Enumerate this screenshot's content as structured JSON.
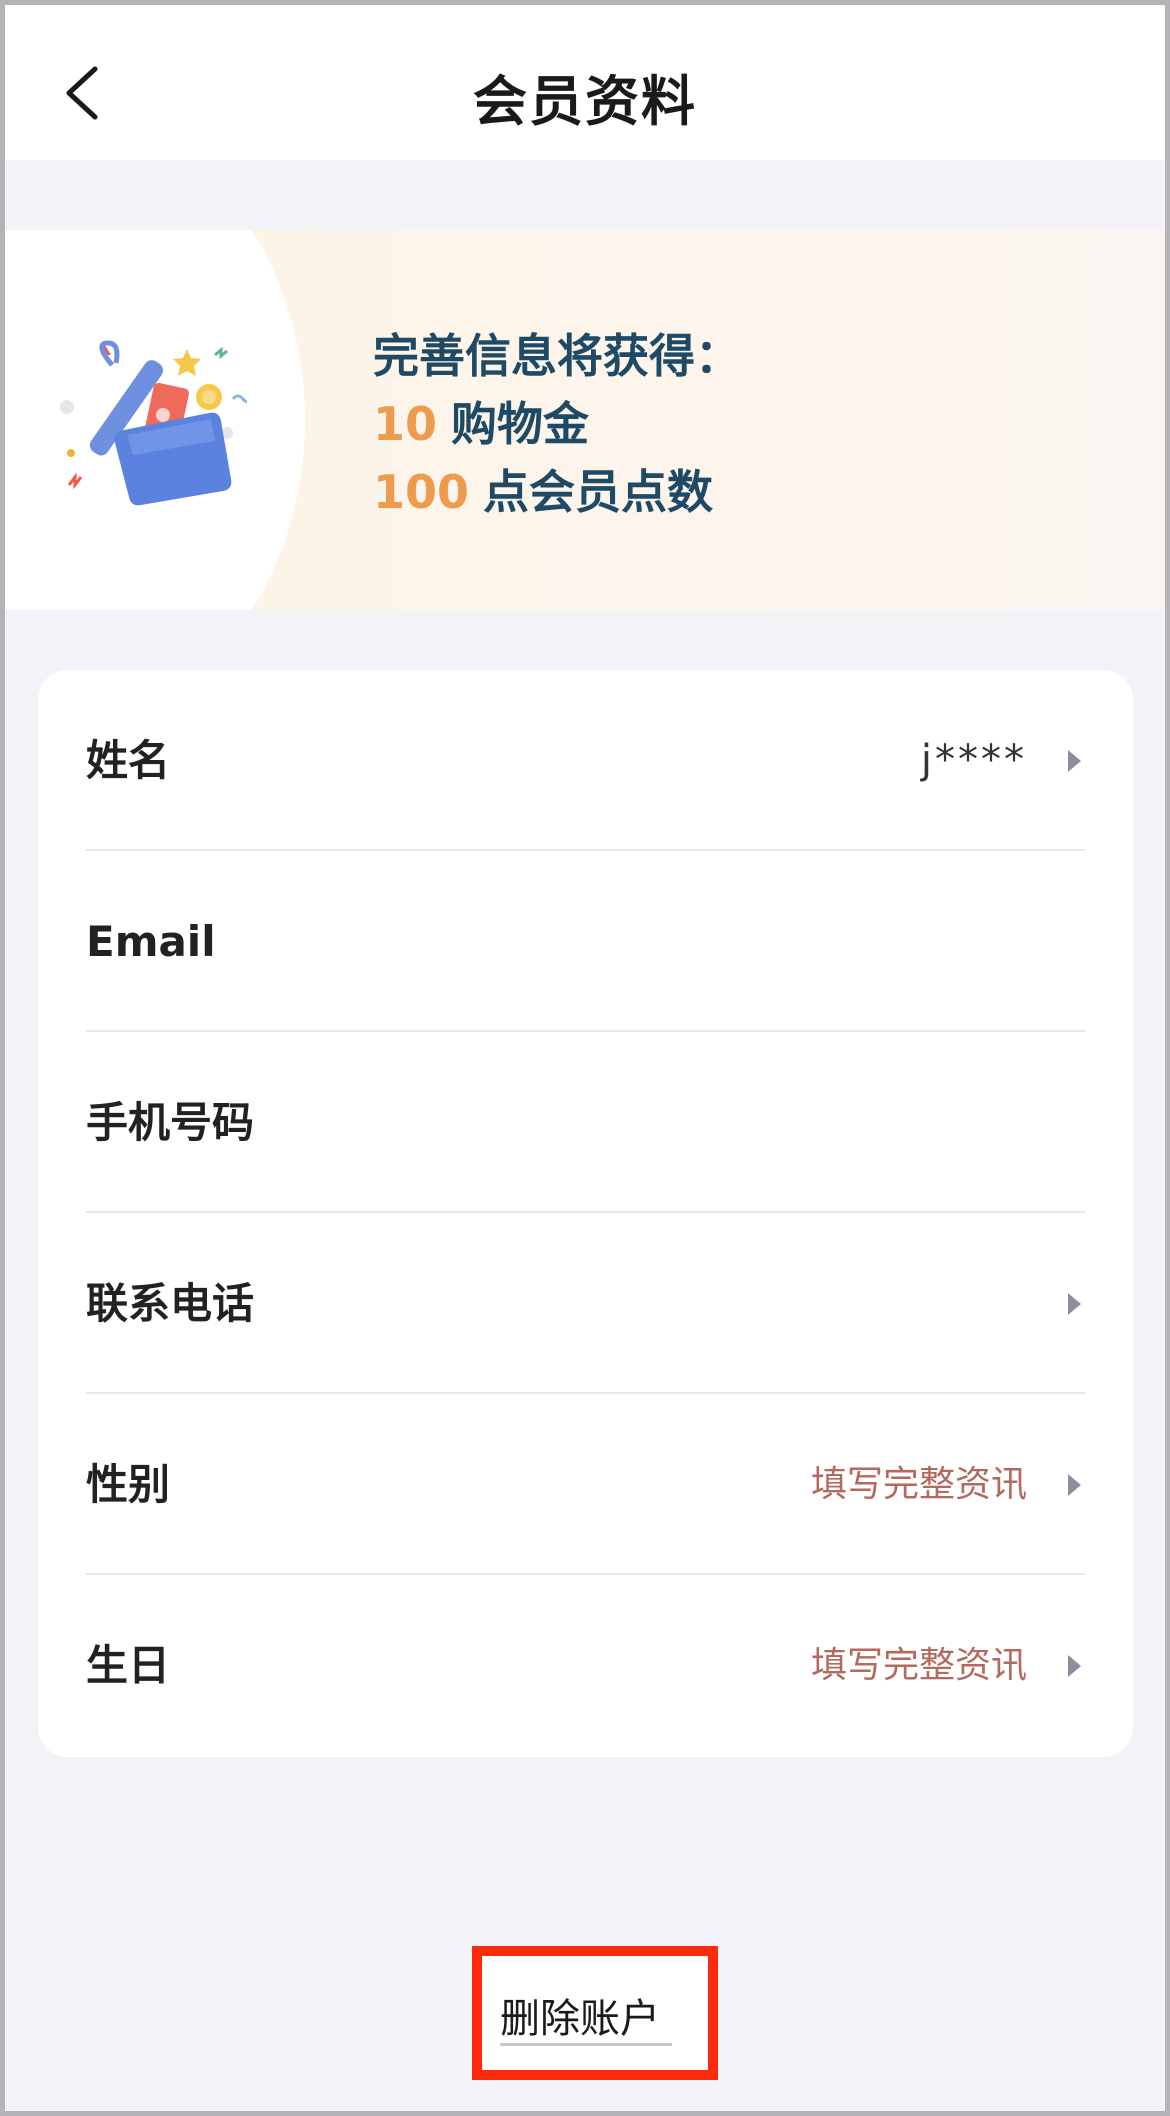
{
  "header": {
    "title": "会员资料",
    "back_icon": "chevron-left-icon"
  },
  "banner": {
    "headline": "完善信息将获得：",
    "rewards": [
      {
        "amount": "10",
        "label": "购物金"
      },
      {
        "amount": "100",
        "label": "点会员点数"
      }
    ],
    "illustration": "gift-box-icon",
    "accent_color": "#ec9c4c",
    "text_color": "#1f4a66"
  },
  "profile": {
    "rows": [
      {
        "label": "姓名",
        "value": "j****"
      },
      {
        "label": "Email",
        "value": ""
      },
      {
        "label": "手机号码",
        "value": ""
      },
      {
        "label": "联系电话",
        "value": ""
      },
      {
        "label": "性别",
        "value": "填写完整资讯"
      },
      {
        "label": "生日",
        "value": "填写完整资讯"
      }
    ],
    "hint_color": "#b36a5c"
  },
  "footer": {
    "delete_label": "删除账户",
    "highlight_color": "#ff2a0a"
  }
}
